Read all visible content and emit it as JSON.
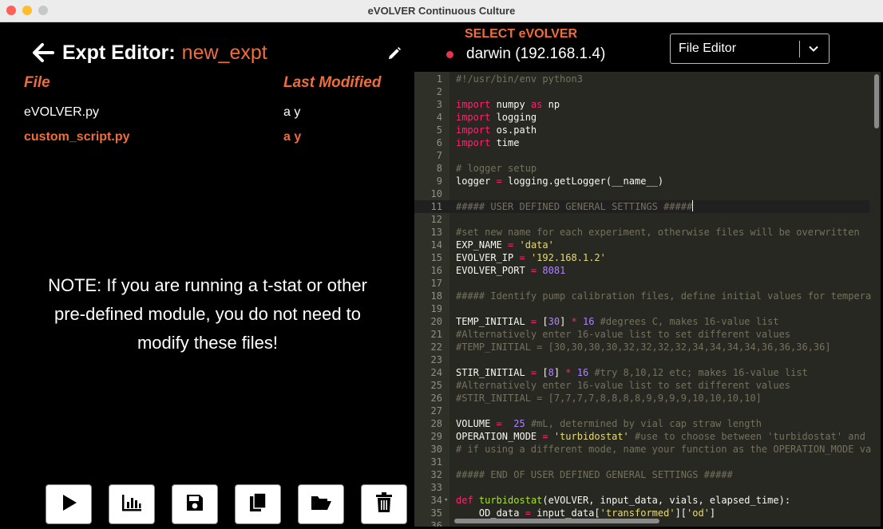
{
  "window": {
    "title": "eVOLVER Continuous Culture"
  },
  "header": {
    "label": "Expt Editor:",
    "experiment_name": "new_expt"
  },
  "files": {
    "col_file": "File",
    "col_modified": "Last Modified",
    "rows": [
      {
        "name": "eVOLVER.py",
        "modified": "a y",
        "selected": false
      },
      {
        "name": "custom_script.py",
        "modified": "a y",
        "selected": true
      }
    ]
  },
  "note": "NOTE: If you are running a t-stat or other pre-defined module, you do not need to modify these files!",
  "toolbar": {
    "buttons": [
      "play-icon",
      "chart-icon",
      "save-icon",
      "copy-icon",
      "folder-open-icon",
      "trash-icon"
    ]
  },
  "device": {
    "select_label": "SELECT eVOLVER",
    "name": "darwin (192.168.1.4)",
    "status_color": "#e8344e"
  },
  "editor_mode": {
    "selected": "File Editor"
  },
  "colors": {
    "accent": "#f06d3b",
    "editor_bg": "#272822"
  },
  "code": {
    "lines": [
      [
        [
          "c",
          "#!/usr/bin/env python3"
        ]
      ],
      [],
      [
        [
          "k",
          "import"
        ],
        [
          "p",
          " numpy "
        ],
        [
          "k",
          "as"
        ],
        [
          "p",
          " np"
        ]
      ],
      [
        [
          "k",
          "import"
        ],
        [
          "p",
          " logging"
        ]
      ],
      [
        [
          "k",
          "import"
        ],
        [
          "p",
          " os.path"
        ]
      ],
      [
        [
          "k",
          "import"
        ],
        [
          "p",
          " time"
        ]
      ],
      [],
      [
        [
          "c",
          "# logger setup"
        ]
      ],
      [
        [
          "p",
          "logger "
        ],
        [
          "k",
          "="
        ],
        [
          "p",
          " logging.getLogger(__name__)"
        ]
      ],
      [],
      [
        [
          "c",
          "##### USER DEFINED GENERAL SETTINGS #####"
        ]
      ],
      [],
      [
        [
          "c",
          "#set new name for each experiment, otherwise files will be overwritten"
        ]
      ],
      [
        [
          "p",
          "EXP_NAME "
        ],
        [
          "k",
          "="
        ],
        [
          "p",
          " "
        ],
        [
          "s",
          "'data'"
        ]
      ],
      [
        [
          "p",
          "EVOLVER_IP "
        ],
        [
          "k",
          "="
        ],
        [
          "p",
          " "
        ],
        [
          "s",
          "'192.168.1.2'"
        ]
      ],
      [
        [
          "p",
          "EVOLVER_PORT "
        ],
        [
          "k",
          "="
        ],
        [
          "p",
          " "
        ],
        [
          "n",
          "8081"
        ]
      ],
      [],
      [
        [
          "c",
          "##### Identify pump calibration files, define initial values for tempera"
        ]
      ],
      [],
      [
        [
          "p",
          "TEMP_INITIAL "
        ],
        [
          "k",
          "="
        ],
        [
          "p",
          " ["
        ],
        [
          "n",
          "30"
        ],
        [
          "p",
          "] "
        ],
        [
          "k",
          "*"
        ],
        [
          "p",
          " "
        ],
        [
          "n",
          "16"
        ],
        [
          "p",
          " "
        ],
        [
          "c",
          "#degrees C, makes 16-value list"
        ]
      ],
      [
        [
          "c",
          "#Alternatively enter 16-value list to set different values"
        ]
      ],
      [
        [
          "c",
          "#TEMP_INITIAL = [30,30,30,30,32,32,32,32,34,34,34,34,36,36,36,36]"
        ]
      ],
      [],
      [
        [
          "p",
          "STIR_INITIAL "
        ],
        [
          "k",
          "="
        ],
        [
          "p",
          " ["
        ],
        [
          "n",
          "8"
        ],
        [
          "p",
          "] "
        ],
        [
          "k",
          "*"
        ],
        [
          "p",
          " "
        ],
        [
          "n",
          "16"
        ],
        [
          "p",
          " "
        ],
        [
          "c",
          "#try 8,10,12 etc; makes 16-value list"
        ]
      ],
      [
        [
          "c",
          "#Alternatively enter 16-value list to set different values"
        ]
      ],
      [
        [
          "c",
          "#STIR_INITIAL = [7,7,7,7,8,8,8,8,9,9,9,9,10,10,10,10]"
        ]
      ],
      [],
      [
        [
          "p",
          "VOLUME "
        ],
        [
          "k",
          "="
        ],
        [
          "p",
          "  "
        ],
        [
          "n",
          "25"
        ],
        [
          "p",
          " "
        ],
        [
          "c",
          "#mL, determined by vial cap straw length"
        ]
      ],
      [
        [
          "p",
          "OPERATION_MODE "
        ],
        [
          "k",
          "="
        ],
        [
          "p",
          " "
        ],
        [
          "s",
          "'turbidostat'"
        ],
        [
          "p",
          " "
        ],
        [
          "c",
          "#use to choose between 'turbidostat' and"
        ]
      ],
      [
        [
          "c",
          "# if using a different mode, name your function as the OPERATION_MODE va"
        ]
      ],
      [],
      [
        [
          "c",
          "##### END OF USER DEFINED GENERAL SETTINGS #####"
        ]
      ],
      [],
      [
        [
          "k",
          "def"
        ],
        [
          "p",
          " "
        ],
        [
          "f",
          "turbidostat"
        ],
        [
          "p",
          "(eVOLVER, input_data, vials, elapsed_time):"
        ]
      ],
      [
        [
          "p",
          "    OD_data "
        ],
        [
          "k",
          "="
        ],
        [
          "p",
          " input_data["
        ],
        [
          "s",
          "'transformed'"
        ],
        [
          "p",
          "]["
        ],
        [
          "s",
          "'od'"
        ],
        [
          "p",
          "]"
        ]
      ],
      []
    ],
    "active_line": 11,
    "fold_line": 34
  }
}
